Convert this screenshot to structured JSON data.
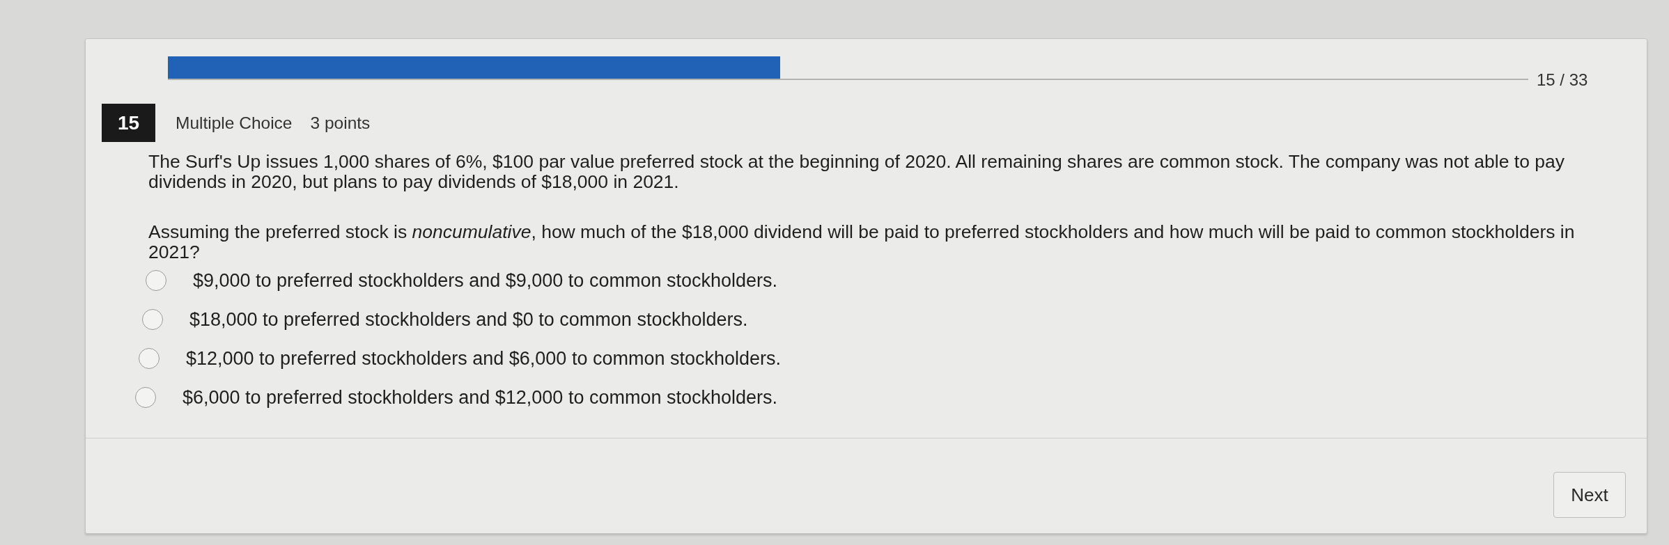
{
  "progress": {
    "level": 0.45,
    "counter": "15 / 33"
  },
  "question": {
    "number": "15",
    "type": "Multiple Choice",
    "points": "3 points",
    "paragraphs": [
      "The Surf's Up issues 1,000 shares of 6%, $100 par value preferred stock at the beginning of 2020. All remaining shares are common stock. The company was not able to pay dividends in 2020, but plans to pay dividends of $18,000 in 2021.",
      "Assuming the preferred stock is *noncumulative*, how much of the $18,000 dividend will be paid to preferred stockholders and how much will be paid to common stockholders in 2021?"
    ]
  },
  "options": [
    {
      "label": "$9,000 to preferred stockholders and $9,000 to common stockholders.",
      "selected": false
    },
    {
      "label": "$18,000 to preferred stockholders and $0 to common stockholders.",
      "selected": false
    },
    {
      "label": "$12,000 to preferred stockholders and $6,000 to common stockholders.",
      "selected": false
    },
    {
      "label": "$6,000 to preferred stockholders and $12,000 to common stockholders.",
      "selected": false
    }
  ],
  "buttons": [
    {
      "label": "Next"
    }
  ]
}
